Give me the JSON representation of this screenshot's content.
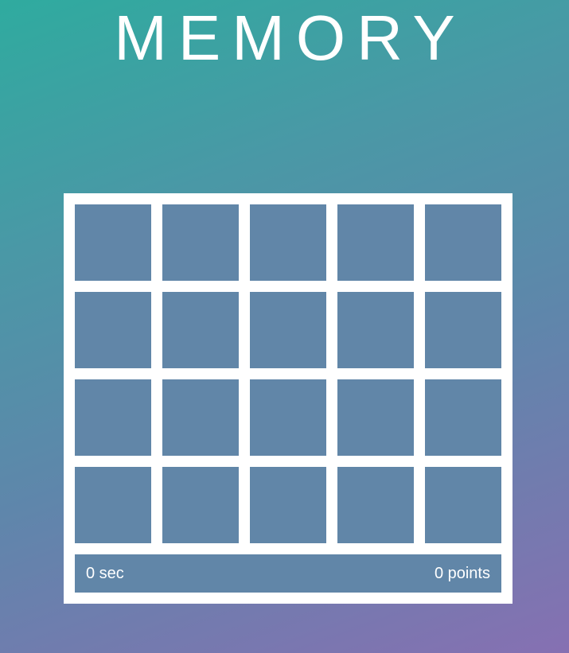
{
  "game": {
    "title": "MEMORY",
    "colors": {
      "card_back": "#6186a8",
      "board": "#ffffff",
      "background_start": "#2fab9f",
      "background_end": "#8670b2"
    },
    "grid": {
      "rows": 4,
      "columns": 5
    },
    "status": {
      "time": "0 sec",
      "score": "0 points"
    }
  }
}
